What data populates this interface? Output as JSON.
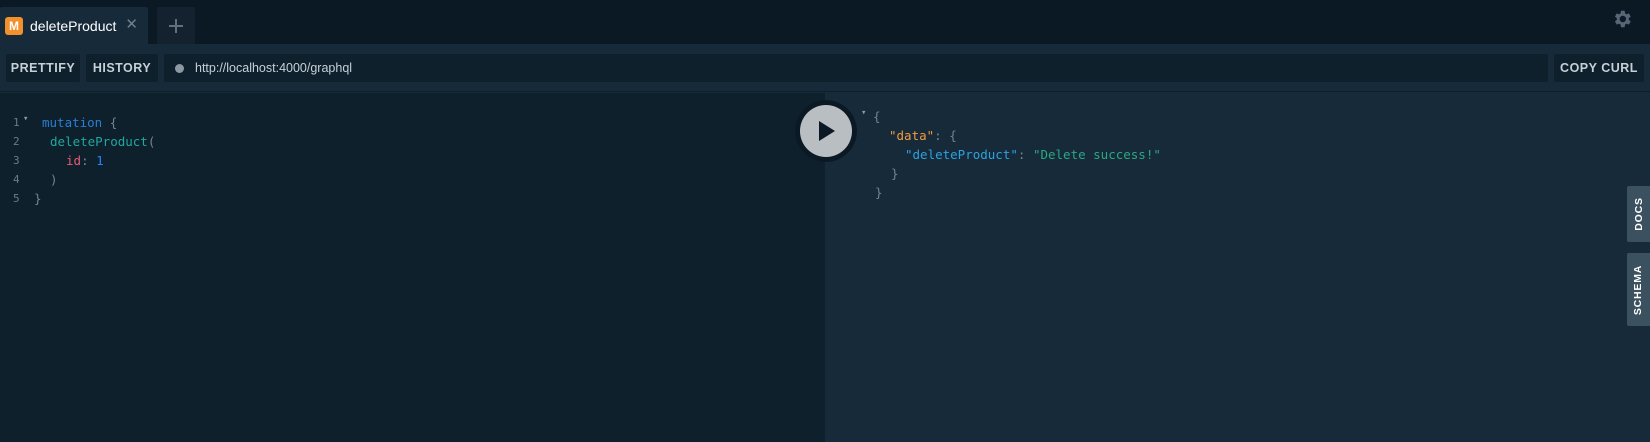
{
  "tabs": [
    {
      "badge": "M",
      "title": "deleteProduct",
      "close": "✕"
    }
  ],
  "new_tab_icon": "plus-icon",
  "settings_icon": "gear-icon",
  "toolbar": {
    "prettify_label": "PRETTIFY",
    "history_label": "HISTORY",
    "url": "http://localhost:4000/graphql",
    "copy_curl_label": "COPY CURL"
  },
  "query": {
    "line_numbers": [
      "1",
      "2",
      "3",
      "4",
      "5"
    ],
    "keyword": "mutation",
    "open_brace": "{",
    "field": "deleteProduct",
    "open_paren": "(",
    "arg_name": "id",
    "colon": ":",
    "arg_value": "1",
    "close_paren": ")",
    "close_brace": "}"
  },
  "result": {
    "open_brace": "{",
    "data_key": "\"data\"",
    "colon": ":",
    "inner_open": "{",
    "field_key": "\"deleteProduct\"",
    "field_value": "\"Delete success!\"",
    "inner_close": "}",
    "close_brace": "}"
  },
  "side_tabs": {
    "docs": "DOCS",
    "schema": "SCHEMA"
  },
  "colors": {
    "accent": "#f2902e",
    "background": "#172a3a",
    "editor_background": "#0f202d"
  }
}
